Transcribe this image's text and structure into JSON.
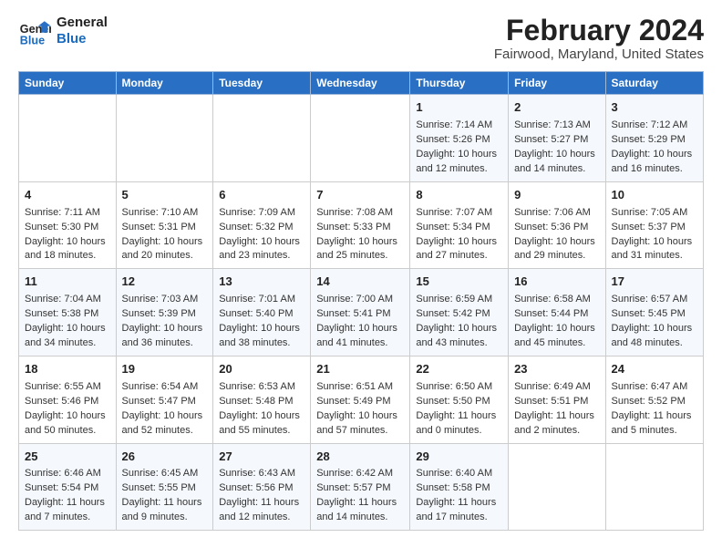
{
  "logo": {
    "line1": "General",
    "line2": "Blue"
  },
  "title": "February 2024",
  "subtitle": "Fairwood, Maryland, United States",
  "days_of_week": [
    "Sunday",
    "Monday",
    "Tuesday",
    "Wednesday",
    "Thursday",
    "Friday",
    "Saturday"
  ],
  "weeks": [
    [
      {
        "day": "",
        "info": ""
      },
      {
        "day": "",
        "info": ""
      },
      {
        "day": "",
        "info": ""
      },
      {
        "day": "",
        "info": ""
      },
      {
        "day": "1",
        "info": "Sunrise: 7:14 AM\nSunset: 5:26 PM\nDaylight: 10 hours\nand 12 minutes."
      },
      {
        "day": "2",
        "info": "Sunrise: 7:13 AM\nSunset: 5:27 PM\nDaylight: 10 hours\nand 14 minutes."
      },
      {
        "day": "3",
        "info": "Sunrise: 7:12 AM\nSunset: 5:29 PM\nDaylight: 10 hours\nand 16 minutes."
      }
    ],
    [
      {
        "day": "4",
        "info": "Sunrise: 7:11 AM\nSunset: 5:30 PM\nDaylight: 10 hours\nand 18 minutes."
      },
      {
        "day": "5",
        "info": "Sunrise: 7:10 AM\nSunset: 5:31 PM\nDaylight: 10 hours\nand 20 minutes."
      },
      {
        "day": "6",
        "info": "Sunrise: 7:09 AM\nSunset: 5:32 PM\nDaylight: 10 hours\nand 23 minutes."
      },
      {
        "day": "7",
        "info": "Sunrise: 7:08 AM\nSunset: 5:33 PM\nDaylight: 10 hours\nand 25 minutes."
      },
      {
        "day": "8",
        "info": "Sunrise: 7:07 AM\nSunset: 5:34 PM\nDaylight: 10 hours\nand 27 minutes."
      },
      {
        "day": "9",
        "info": "Sunrise: 7:06 AM\nSunset: 5:36 PM\nDaylight: 10 hours\nand 29 minutes."
      },
      {
        "day": "10",
        "info": "Sunrise: 7:05 AM\nSunset: 5:37 PM\nDaylight: 10 hours\nand 31 minutes."
      }
    ],
    [
      {
        "day": "11",
        "info": "Sunrise: 7:04 AM\nSunset: 5:38 PM\nDaylight: 10 hours\nand 34 minutes."
      },
      {
        "day": "12",
        "info": "Sunrise: 7:03 AM\nSunset: 5:39 PM\nDaylight: 10 hours\nand 36 minutes."
      },
      {
        "day": "13",
        "info": "Sunrise: 7:01 AM\nSunset: 5:40 PM\nDaylight: 10 hours\nand 38 minutes."
      },
      {
        "day": "14",
        "info": "Sunrise: 7:00 AM\nSunset: 5:41 PM\nDaylight: 10 hours\nand 41 minutes."
      },
      {
        "day": "15",
        "info": "Sunrise: 6:59 AM\nSunset: 5:42 PM\nDaylight: 10 hours\nand 43 minutes."
      },
      {
        "day": "16",
        "info": "Sunrise: 6:58 AM\nSunset: 5:44 PM\nDaylight: 10 hours\nand 45 minutes."
      },
      {
        "day": "17",
        "info": "Sunrise: 6:57 AM\nSunset: 5:45 PM\nDaylight: 10 hours\nand 48 minutes."
      }
    ],
    [
      {
        "day": "18",
        "info": "Sunrise: 6:55 AM\nSunset: 5:46 PM\nDaylight: 10 hours\nand 50 minutes."
      },
      {
        "day": "19",
        "info": "Sunrise: 6:54 AM\nSunset: 5:47 PM\nDaylight: 10 hours\nand 52 minutes."
      },
      {
        "day": "20",
        "info": "Sunrise: 6:53 AM\nSunset: 5:48 PM\nDaylight: 10 hours\nand 55 minutes."
      },
      {
        "day": "21",
        "info": "Sunrise: 6:51 AM\nSunset: 5:49 PM\nDaylight: 10 hours\nand 57 minutes."
      },
      {
        "day": "22",
        "info": "Sunrise: 6:50 AM\nSunset: 5:50 PM\nDaylight: 11 hours\nand 0 minutes."
      },
      {
        "day": "23",
        "info": "Sunrise: 6:49 AM\nSunset: 5:51 PM\nDaylight: 11 hours\nand 2 minutes."
      },
      {
        "day": "24",
        "info": "Sunrise: 6:47 AM\nSunset: 5:52 PM\nDaylight: 11 hours\nand 5 minutes."
      }
    ],
    [
      {
        "day": "25",
        "info": "Sunrise: 6:46 AM\nSunset: 5:54 PM\nDaylight: 11 hours\nand 7 minutes."
      },
      {
        "day": "26",
        "info": "Sunrise: 6:45 AM\nSunset: 5:55 PM\nDaylight: 11 hours\nand 9 minutes."
      },
      {
        "day": "27",
        "info": "Sunrise: 6:43 AM\nSunset: 5:56 PM\nDaylight: 11 hours\nand 12 minutes."
      },
      {
        "day": "28",
        "info": "Sunrise: 6:42 AM\nSunset: 5:57 PM\nDaylight: 11 hours\nand 14 minutes."
      },
      {
        "day": "29",
        "info": "Sunrise: 6:40 AM\nSunset: 5:58 PM\nDaylight: 11 hours\nand 17 minutes."
      },
      {
        "day": "",
        "info": ""
      },
      {
        "day": "",
        "info": ""
      }
    ]
  ]
}
